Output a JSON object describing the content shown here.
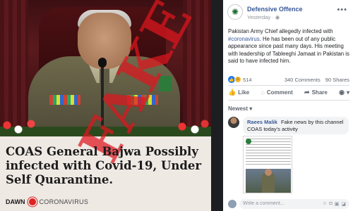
{
  "article": {
    "stamp": "FAKE",
    "headline": "COAS General Bajwa Possibly infected with Covid-19, Under Self Quarantine.",
    "brand": "DAWN",
    "brand_sub": "CORONAVIRUS"
  },
  "post": {
    "page_name": "Defensive Offence",
    "time": "Yesterday",
    "time_icon": "globe-icon",
    "more_label": "•••",
    "text_before_hashtag": "Pakistan Army Chief allegedly infected with",
    "hashtag": "#coronavirus",
    "text_after_hashtag": ". He has been out of any public appearance since past many days. His meeting with leadership of Tableeghi Jamaat in Pakistan is said to have infected him.",
    "reaction_count": "514",
    "comments_count": "340 Comments",
    "shares_count": "90 Shares",
    "actions": {
      "like": "Like",
      "comment": "Comment",
      "share": "Share"
    },
    "sort_label": "Newest",
    "comment": {
      "author": "Raees Malik",
      "text": "Fake news by this channel COAS today's activity"
    },
    "comment_placeholder": "Write a comment..."
  },
  "colors": {
    "fb_link": "#385898",
    "stamp_red": "#e61e28",
    "like_blue": "#1877f2"
  }
}
